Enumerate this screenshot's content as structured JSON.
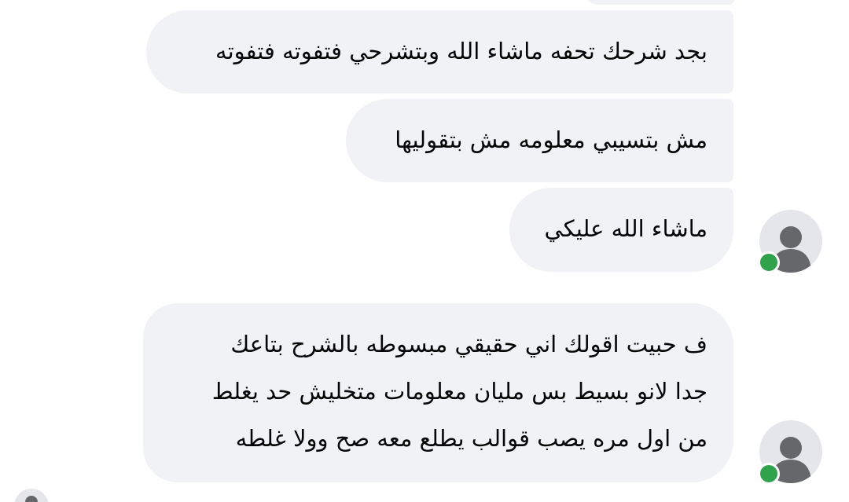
{
  "conversation": {
    "messages": [
      {
        "lines": [
          ""
        ]
      },
      {
        "lines": [
          "بجد شرحك تحفه ماشاء الله وبتشرحي فتفوته فتفوته"
        ]
      },
      {
        "lines": [
          "مش بتسيبي معلومه مش بتقوليها"
        ]
      },
      {
        "lines": [
          "ماشاء الله عليكي"
        ]
      },
      {
        "lines": [
          "ف حبيت اقولك اني حقيقي مبسوطه بالشرح بتاعك",
          "جدا لانو بسيط بس مليان معلومات متخليش حد يغلط",
          "من اول مره يصب قوالب يطلع معه صح وولا غلطه"
        ]
      }
    ]
  },
  "icons": {
    "avatar": "default-user-avatar-icon",
    "presence": "online-status-dot"
  },
  "colors": {
    "bubble_bg": "#f0f2f5",
    "text": "#050505",
    "avatar_bg": "#e4e6eb",
    "avatar_silhouette": "#65676b",
    "online": "#31a24c"
  }
}
